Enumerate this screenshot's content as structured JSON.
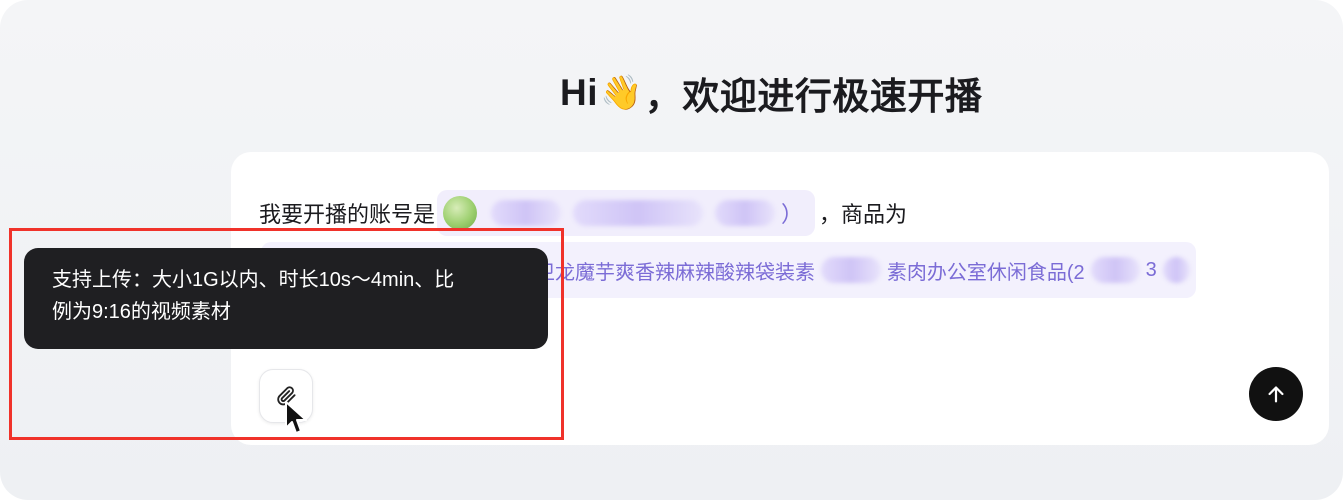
{
  "header": {
    "greeting": "Hi",
    "wave_emoji": "👋",
    "title_rest": "，欢迎进行极速开播"
  },
  "composer": {
    "prefix": "我要开播的账号是",
    "account_suffix": "）",
    "middle": "，商品为",
    "product_visible_1": "卫龙魔芋爽香辣麻辣酸辣袋装素",
    "product_visible_2": "素肉办公室休闲食品(2",
    "product_visible_3": "3",
    "attach_icon": "paperclip-icon",
    "send_icon": "arrow-up-icon"
  },
  "tooltip": {
    "line1": "支持上传：大小1G以内、时长10s～4min、比",
    "line2": "例为9:16的视频素材"
  },
  "colors": {
    "annotation_box": "#f0322a",
    "chip_text": "#7b6cd6",
    "send_button": "#111111"
  }
}
